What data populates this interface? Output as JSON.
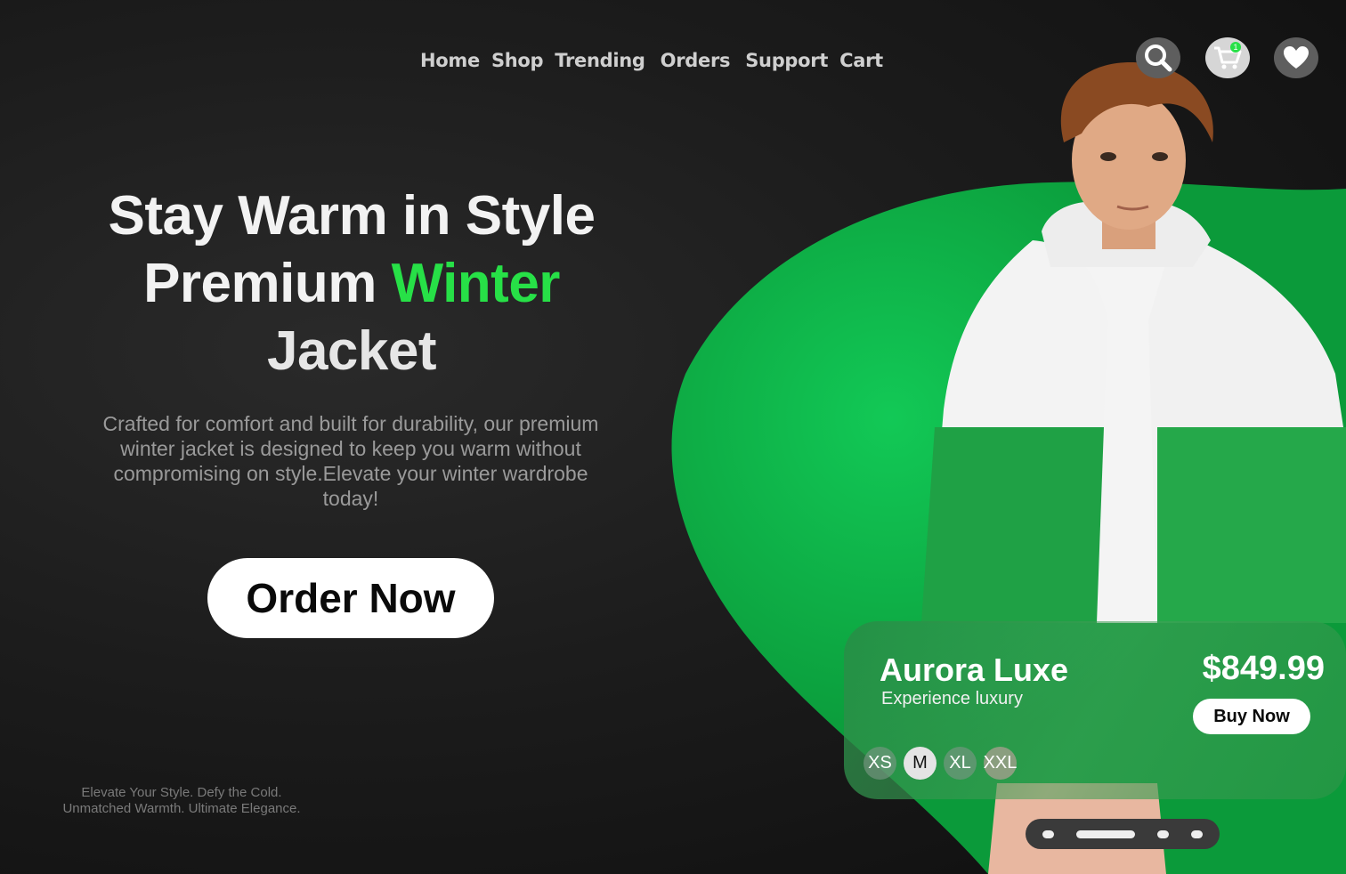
{
  "nav": {
    "items": [
      "Home",
      "Shop",
      "Trending",
      "Orders",
      "Support",
      "Cart"
    ]
  },
  "header_icons": {
    "search": "search-icon",
    "cart": "cart-icon",
    "cart_badge": "1",
    "wishlist": "heart-icon"
  },
  "hero": {
    "line1": "Stay Warm in Style",
    "line2_a": "Premium ",
    "line2_b": "Winter",
    "line3": "Jacket",
    "description": "Crafted for comfort and built for durability, our premium winter jacket is designed to keep you warm without compromising on style.Elevate your winter wardrobe today!",
    "cta": "Order Now"
  },
  "tagline": {
    "line1": "Elevate Your Style. Defy the Cold.",
    "line2": "Unmatched Warmth. Ultimate Elegance."
  },
  "product_card": {
    "name": "Aurora Luxe",
    "subtitle": "Experience luxury",
    "price": "$849.99",
    "buy_label": "Buy Now",
    "sizes": [
      "XS",
      "M",
      "XL",
      "XXL"
    ],
    "selected_size": "M"
  },
  "carousel": {
    "slides": 4,
    "active_index": 1
  },
  "colors": {
    "accent": "#27e047",
    "blob": "#10b34a",
    "background": "#1c1c1c"
  }
}
